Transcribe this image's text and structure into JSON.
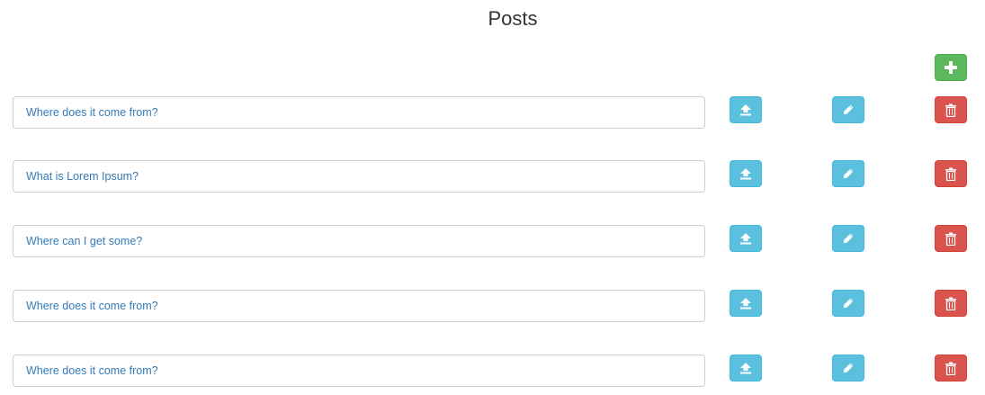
{
  "page": {
    "title": "Posts"
  },
  "toolbar": {
    "add_icon": "plus-icon"
  },
  "colors": {
    "success": "#5cb85c",
    "info": "#5bc0de",
    "danger": "#d9534f",
    "link": "#337ab7"
  },
  "posts": [
    {
      "title": "Where does it come from?"
    },
    {
      "title": "What is Lorem Ipsum?"
    },
    {
      "title": "Where can I get some?"
    },
    {
      "title": "Where does it come from?"
    },
    {
      "title": "Where does it come from?"
    }
  ],
  "row_actions": {
    "publish_icon": "upload-icon",
    "edit_icon": "pencil-icon",
    "delete_icon": "trash-icon"
  }
}
